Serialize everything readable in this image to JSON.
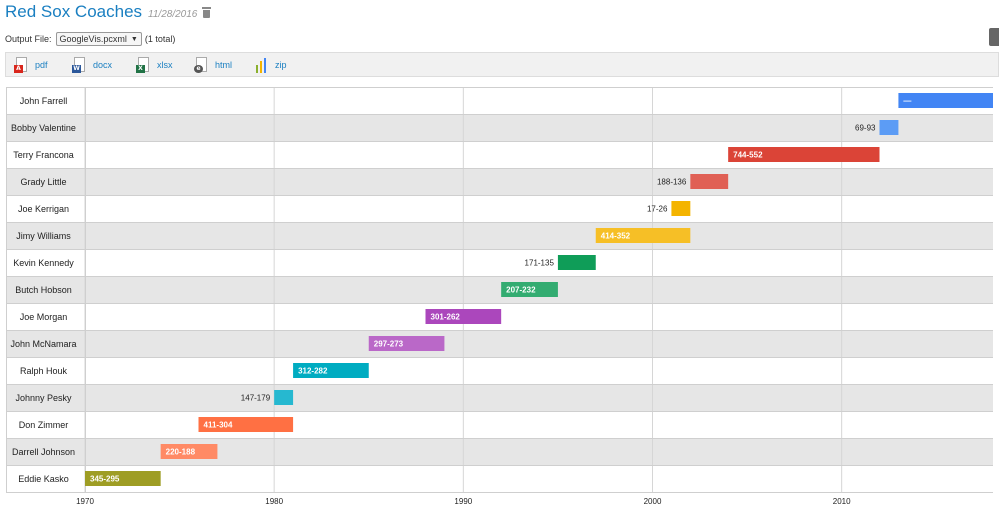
{
  "header": {
    "title": "Red Sox Coaches",
    "date": "11/28/2016",
    "output_label": "Output File:",
    "output_value": "GoogleVis.pcxml",
    "output_total": "(1 total)"
  },
  "exports": [
    {
      "label": "pdf",
      "icon": "pdf-icon",
      "color": "#d9261c"
    },
    {
      "label": "docx",
      "icon": "word-icon",
      "color": "#2b579a"
    },
    {
      "label": "xlsx",
      "icon": "excel-icon",
      "color": "#217346"
    },
    {
      "label": "html",
      "icon": "html-icon",
      "color": "#555555"
    },
    {
      "label": "zip",
      "icon": "zip-icon",
      "color": "#8ab02e"
    }
  ],
  "chart_data": {
    "type": "timeline",
    "x": {
      "min": 1970,
      "max": 2018,
      "ticks": [
        1970,
        1980,
        1990,
        2000,
        2010
      ]
    },
    "rows": [
      {
        "name": "John Farrell",
        "start": 2013,
        "end": 2018,
        "label": "—",
        "color": "#4285f4"
      },
      {
        "name": "Bobby Valentine",
        "start": 2012,
        "end": 2013,
        "label": "69-93",
        "color": "#5c9cf5"
      },
      {
        "name": "Terry Francona",
        "start": 2004,
        "end": 2012,
        "label": "744-552",
        "color": "#db4437"
      },
      {
        "name": "Grady Little",
        "start": 2002,
        "end": 2004,
        "label": "188-136",
        "color": "#e06055"
      },
      {
        "name": "Joe Kerrigan",
        "start": 2001,
        "end": 2002,
        "label": "17-26",
        "color": "#f4b400"
      },
      {
        "name": "Jimy Williams",
        "start": 1997,
        "end": 2002,
        "label": "414-352",
        "color": "#f6bf26"
      },
      {
        "name": "Kevin Kennedy",
        "start": 1995,
        "end": 1997,
        "label": "171-135",
        "color": "#0f9d58"
      },
      {
        "name": "Butch Hobson",
        "start": 1992,
        "end": 1995,
        "label": "207-232",
        "color": "#33ac71"
      },
      {
        "name": "Joe Morgan",
        "start": 1988,
        "end": 1992,
        "label": "301-262",
        "color": "#ab47bc"
      },
      {
        "name": "John McNamara",
        "start": 1985,
        "end": 1989,
        "label": "297-273",
        "color": "#ba68c8"
      },
      {
        "name": "Ralph Houk",
        "start": 1981,
        "end": 1985,
        "label": "312-282",
        "color": "#00acc1"
      },
      {
        "name": "Johnny Pesky",
        "start": 1980,
        "end": 1981,
        "label": "147-179",
        "color": "#26b8d0"
      },
      {
        "name": "Don Zimmer",
        "start": 1976,
        "end": 1981,
        "label": "411-304",
        "color": "#ff7043"
      },
      {
        "name": "Darrell Johnson",
        "start": 1974,
        "end": 1977,
        "label": "220-188",
        "color": "#ff8a65"
      },
      {
        "name": "Eddie Kasko",
        "start": 1970,
        "end": 1974,
        "label": "345-295",
        "color": "#9e9d24"
      }
    ]
  }
}
